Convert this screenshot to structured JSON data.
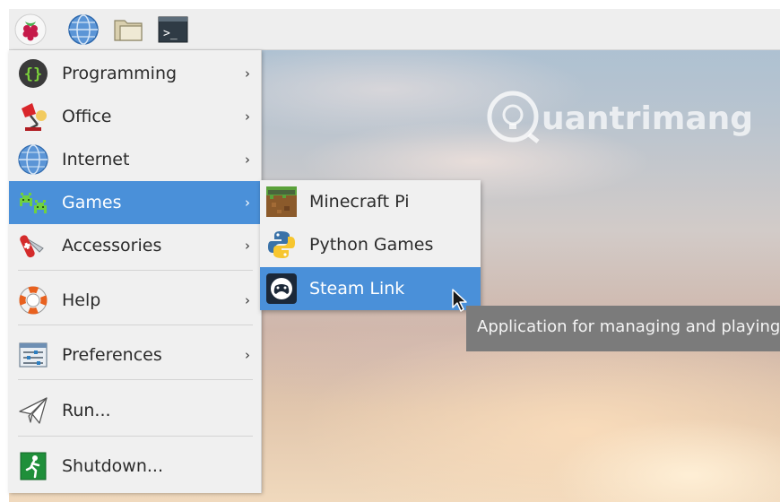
{
  "taskbar": {
    "icons": [
      "raspberry-menu-icon",
      "web-browser-icon",
      "file-manager-icon",
      "terminal-icon"
    ],
    "terminal_prompt": ">_"
  },
  "watermark": {
    "logo_text": "Quantrimang"
  },
  "main_menu": {
    "items": [
      {
        "label": "Programming",
        "icon": "programming-braces-icon",
        "has_submenu": true
      },
      {
        "label": "Office",
        "icon": "office-lamp-icon",
        "has_submenu": true
      },
      {
        "label": "Internet",
        "icon": "internet-globe-icon",
        "has_submenu": true
      },
      {
        "label": "Games",
        "icon": "games-invaders-icon",
        "has_submenu": true,
        "active": true
      },
      {
        "label": "Accessories",
        "icon": "accessories-knife-icon",
        "has_submenu": true
      },
      {
        "label": "Help",
        "icon": "help-lifebuoy-icon",
        "has_submenu": true
      },
      {
        "label": "Preferences",
        "icon": "preferences-sliders-icon",
        "has_submenu": true
      },
      {
        "label": "Run...",
        "icon": "run-paper-plane-icon",
        "has_submenu": false
      },
      {
        "label": "Shutdown...",
        "icon": "shutdown-exit-icon",
        "has_submenu": false
      }
    ],
    "arrow_glyph": "›"
  },
  "games_submenu": {
    "items": [
      {
        "label": "Minecraft Pi",
        "icon": "minecraft-icon"
      },
      {
        "label": "Python Games",
        "icon": "python-icon"
      },
      {
        "label": "Steam Link",
        "icon": "steam-link-icon",
        "active": true
      }
    ]
  },
  "tooltip": {
    "text": "Application for managing and playing"
  },
  "colors": {
    "highlight": "#4a90d9",
    "menu_bg": "#f0f0f0",
    "taskbar_bg": "#eeeeee",
    "tooltip_bg": "#7b7b7b"
  }
}
